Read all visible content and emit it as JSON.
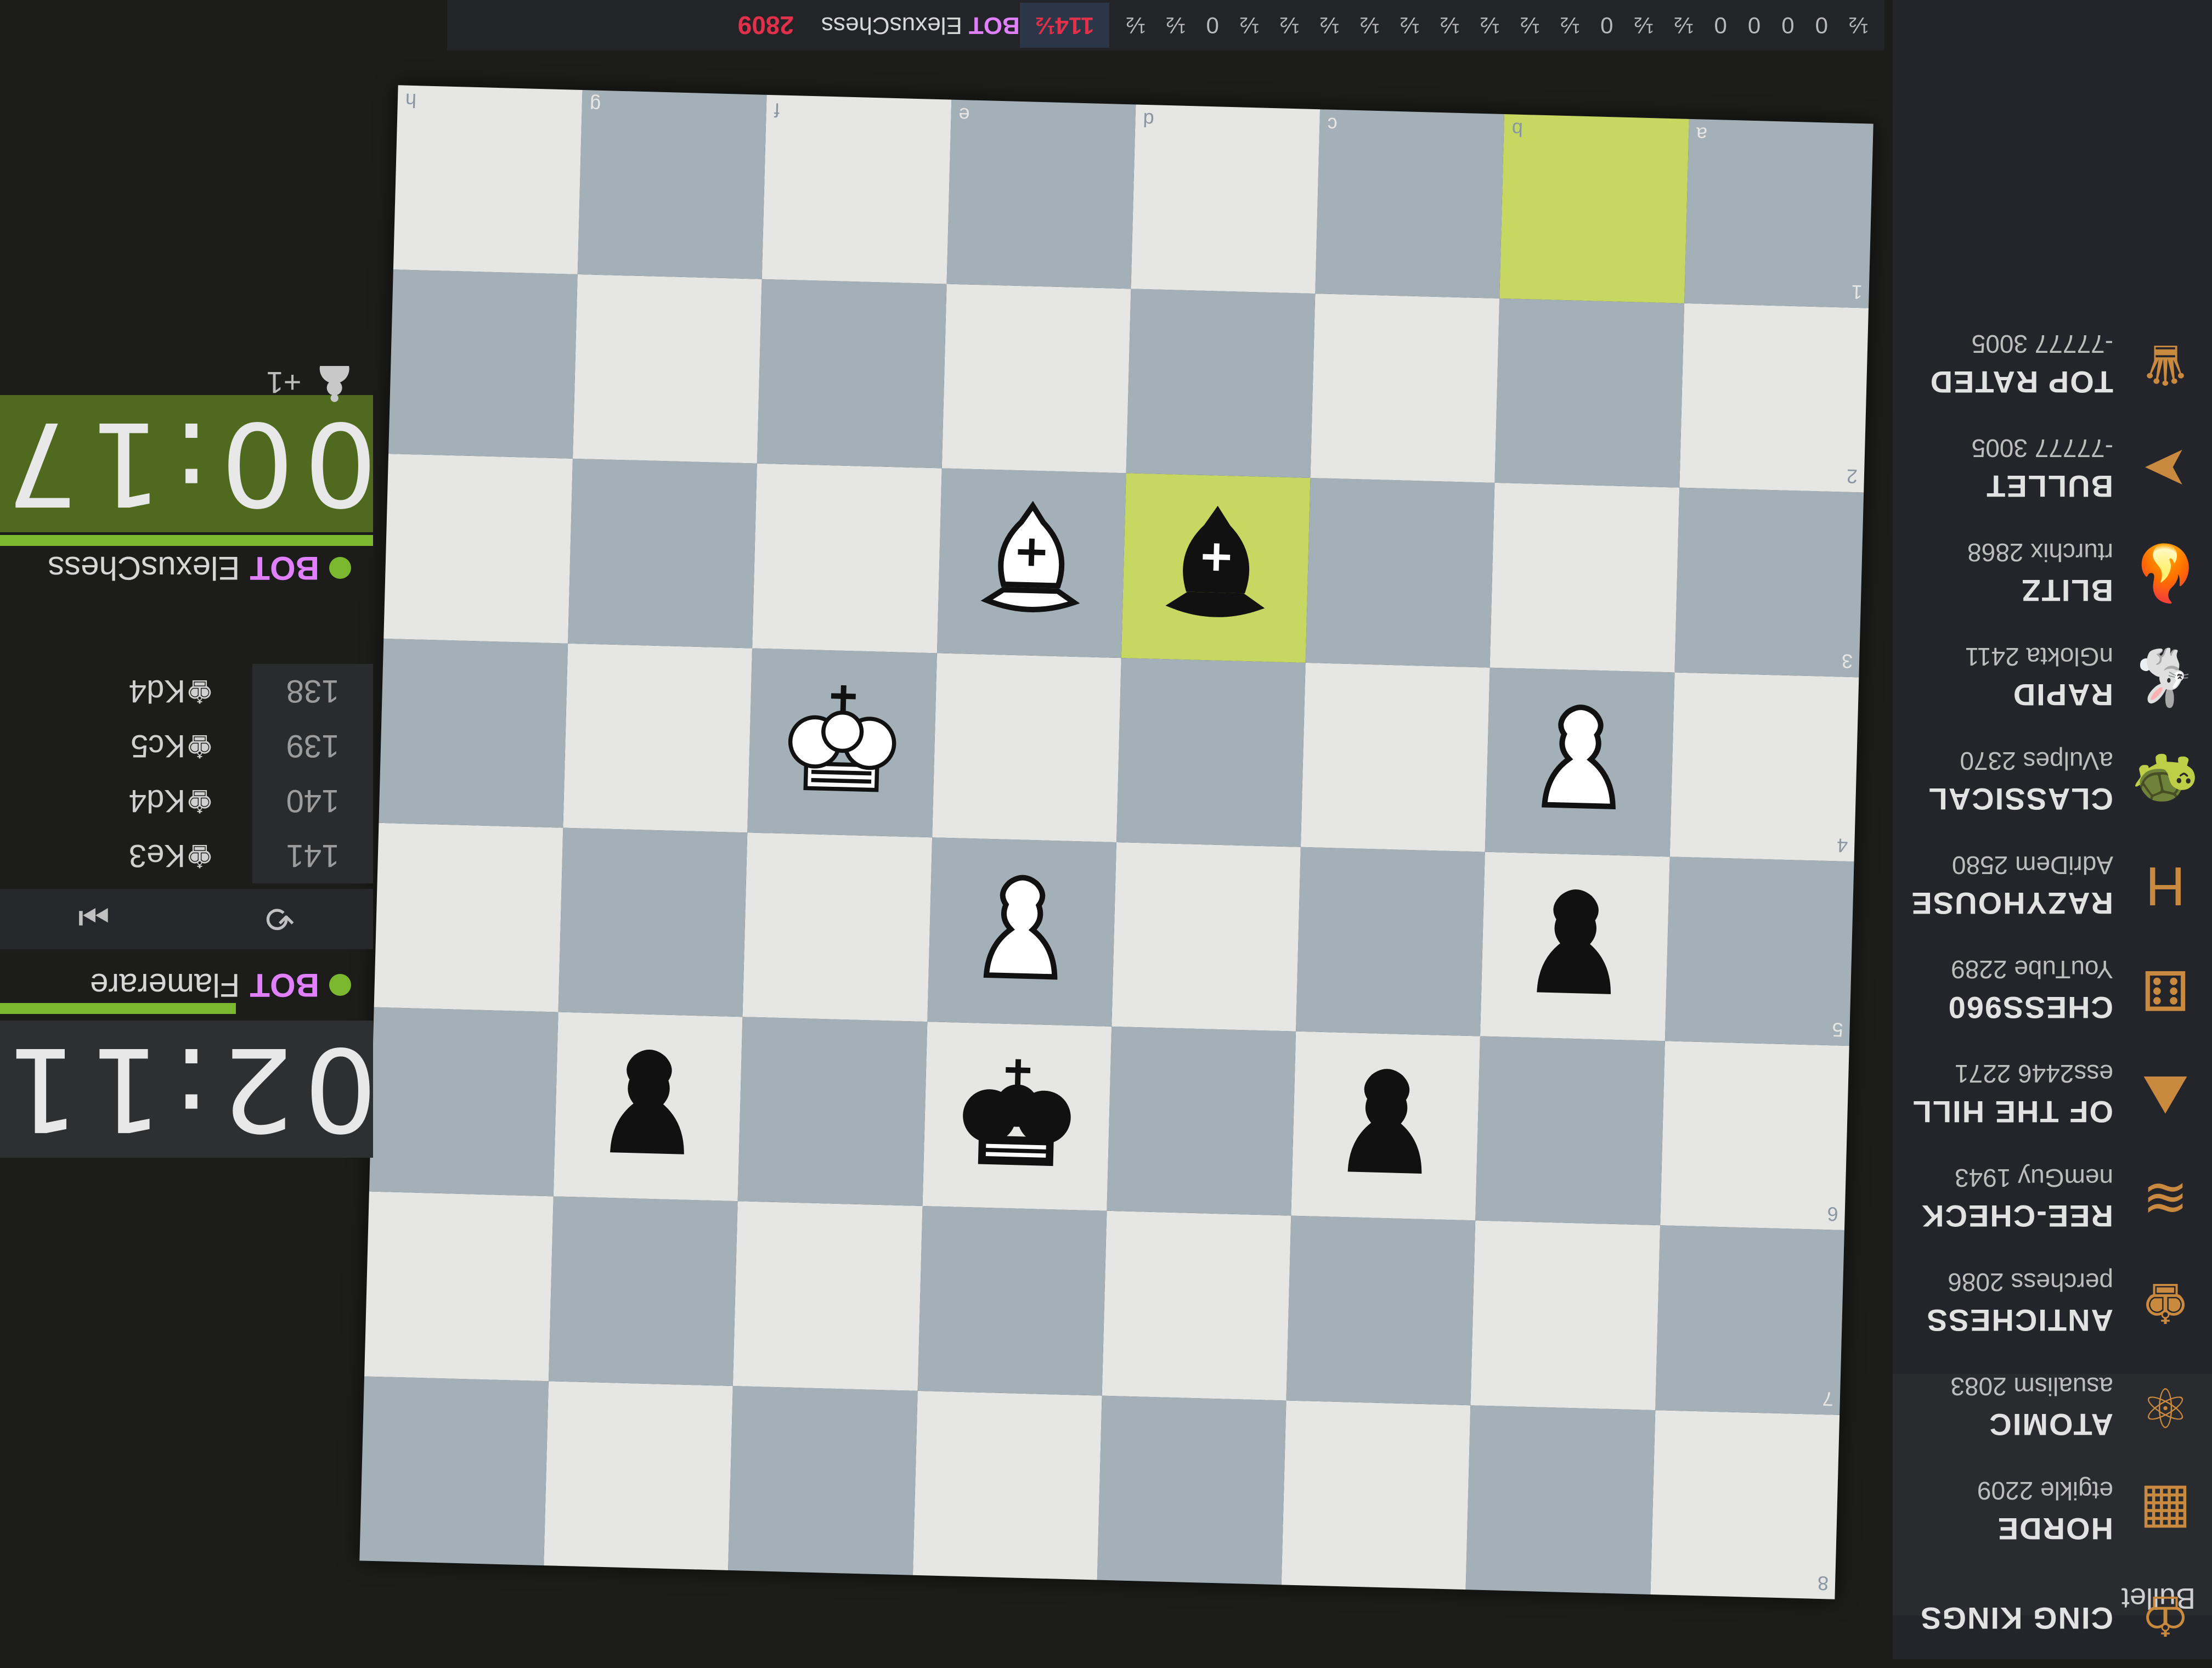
{
  "top_strip": {
    "opponent_rating": "2809",
    "bot_tag": "BOT",
    "bot_name": "ElexusChess",
    "score": "114½",
    "results": [
      "½",
      "0",
      "0",
      "0",
      "0",
      "½",
      "½",
      "0",
      "½",
      "½",
      "½",
      "½",
      "½",
      "½",
      "½",
      "½",
      "½",
      "0",
      "½",
      "½"
    ]
  },
  "board": {
    "files": [
      "a",
      "b",
      "c",
      "d",
      "e",
      "f",
      "g",
      "h"
    ],
    "ranks": [
      "8",
      "7",
      "6",
      "5",
      "4",
      "3",
      "2",
      "1"
    ],
    "highlight": [
      "d3",
      "b1"
    ],
    "pieces": [
      {
        "square": "c6",
        "type": "pawn",
        "color": "black"
      },
      {
        "square": "e6",
        "type": "king",
        "color": "black"
      },
      {
        "square": "g6",
        "type": "pawn",
        "color": "black"
      },
      {
        "square": "b5",
        "type": "pawn",
        "color": "black"
      },
      {
        "square": "e5",
        "type": "pawn",
        "color": "white"
      },
      {
        "square": "b4",
        "type": "pawn",
        "color": "white"
      },
      {
        "square": "f4",
        "type": "king",
        "color": "white"
      },
      {
        "square": "d3",
        "type": "bishop",
        "color": "black"
      },
      {
        "square": "e3",
        "type": "bishop",
        "color": "white"
      }
    ]
  },
  "left_panel": {
    "clock_top": "02:11",
    "clock_bottom": "00:17",
    "player_top": {
      "tag": "BOT",
      "name": "Flamerare"
    },
    "player_bottom": {
      "tag": "BOT",
      "name": "ElexusChess"
    },
    "captured": "+1",
    "moves": [
      {
        "num": "138",
        "move": "Kd4"
      },
      {
        "num": "139",
        "move": "Kc5"
      },
      {
        "num": "140",
        "move": "Kd4"
      },
      {
        "num": "141",
        "move": "Ke3"
      }
    ],
    "controls": {
      "flip": "⟲",
      "last": "⏭"
    }
  },
  "sidebar": {
    "modes": [
      {
        "title": "TOP RATED",
        "sub": "-77777 3005",
        "icon": "crown-icon",
        "glyph": "♛"
      },
      {
        "title": "BULLET",
        "sub": "-77777 3005",
        "icon": "bullet-icon",
        "glyph": "➤"
      },
      {
        "title": "BLITZ",
        "sub": "rturchix 2868",
        "icon": "fire-icon",
        "glyph": "🔥"
      },
      {
        "title": "RAPID",
        "sub": "nGlokta 2411",
        "icon": "rabbit-icon",
        "glyph": "🐇"
      },
      {
        "title": "CLASSICAL",
        "sub": "aVulpes 2370",
        "icon": "turtle-icon",
        "glyph": "🐢"
      },
      {
        "title": "RAZYHOUSE",
        "sub": "AdriDem 2580",
        "icon": "crazyhouse-icon",
        "glyph": "H"
      },
      {
        "title": "CHESS960",
        "sub": "YouTube 2289",
        "icon": "dice-icon",
        "glyph": "⚅"
      },
      {
        "title": "OF THE HILL",
        "sub": "ess2446 2271",
        "icon": "hill-icon",
        "glyph": "⛰"
      },
      {
        "title": "REE-CHECK",
        "sub": "nemGuy 1943",
        "icon": "three-check-icon",
        "glyph": "≋"
      },
      {
        "title": "ANTICHESS",
        "sub": "perchess 2086",
        "icon": "king-icon",
        "glyph": "♚"
      },
      {
        "title": "ATOMIC",
        "sub": "asualism 2083",
        "icon": "atom-icon",
        "glyph": "⚛"
      },
      {
        "title": "HORDE",
        "sub": "etgikle 2209",
        "icon": "horde-icon",
        "glyph": "▦"
      },
      {
        "title": "CING KINGS",
        "sub": "",
        "icon": "racing-icon",
        "glyph": "♔"
      }
    ],
    "bottom_label": "Bullet"
  },
  "colors": {
    "light_square": "#e6e6e4",
    "dark_square": "#a3b0b8",
    "highlight": "#c6d862",
    "accent_green": "#7cb82f",
    "bot_tag": "#e080ff",
    "mode_icon": "#c9893e"
  }
}
